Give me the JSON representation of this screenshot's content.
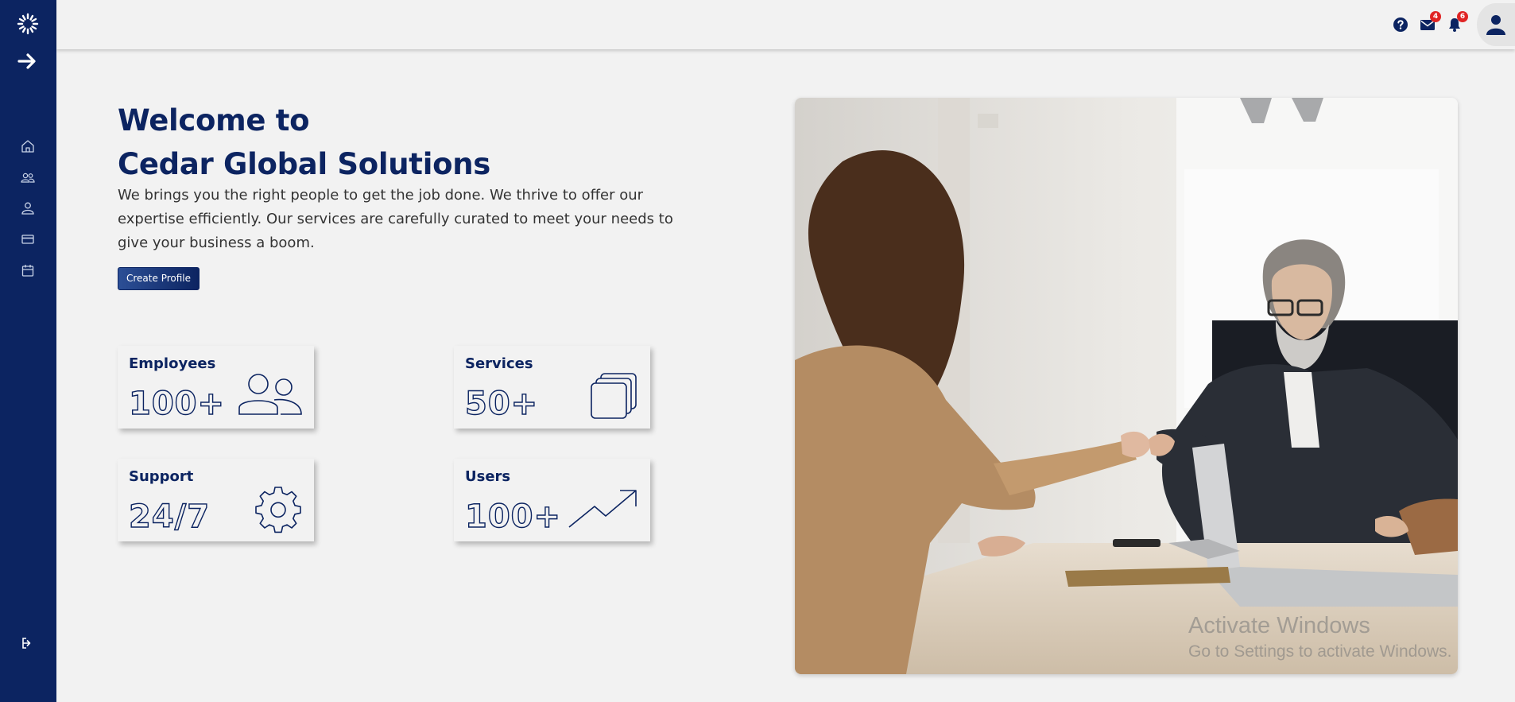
{
  "header": {
    "help_icon": "question-circle-icon",
    "mail_badge": "4",
    "notifications_badge": "6"
  },
  "sidebar": {
    "items": [
      {
        "icon": "home-icon"
      },
      {
        "icon": "users-icon"
      },
      {
        "icon": "user-icon"
      },
      {
        "icon": "credit-card-icon"
      },
      {
        "icon": "calendar-icon"
      }
    ],
    "logout_icon": "logout-icon"
  },
  "hero": {
    "title_line1": "Welcome to",
    "title_line2": "Cedar Global Solutions",
    "description": "We brings you the right people to get the job done. We thrive to offer our expertise efficiently. Our services are carefully curated to meet your needs to give your business a boom.",
    "cta_label": "Create Profile"
  },
  "stats": [
    {
      "label": "Employees",
      "value": "100+",
      "icon": "users-outline-icon"
    },
    {
      "label": "Services",
      "value": "50+",
      "icon": "stacked-squares-icon"
    },
    {
      "label": "Support",
      "value": "24/7",
      "icon": "gear-icon"
    },
    {
      "label": "Users",
      "value": "100+",
      "icon": "trending-up-icon"
    }
  ],
  "watermark": {
    "line1": "Activate Windows",
    "line2": "Go to Settings to activate Windows."
  },
  "colors": {
    "brand": "#0c2461",
    "background": "#f2f2f2",
    "badge": "#e02424"
  }
}
